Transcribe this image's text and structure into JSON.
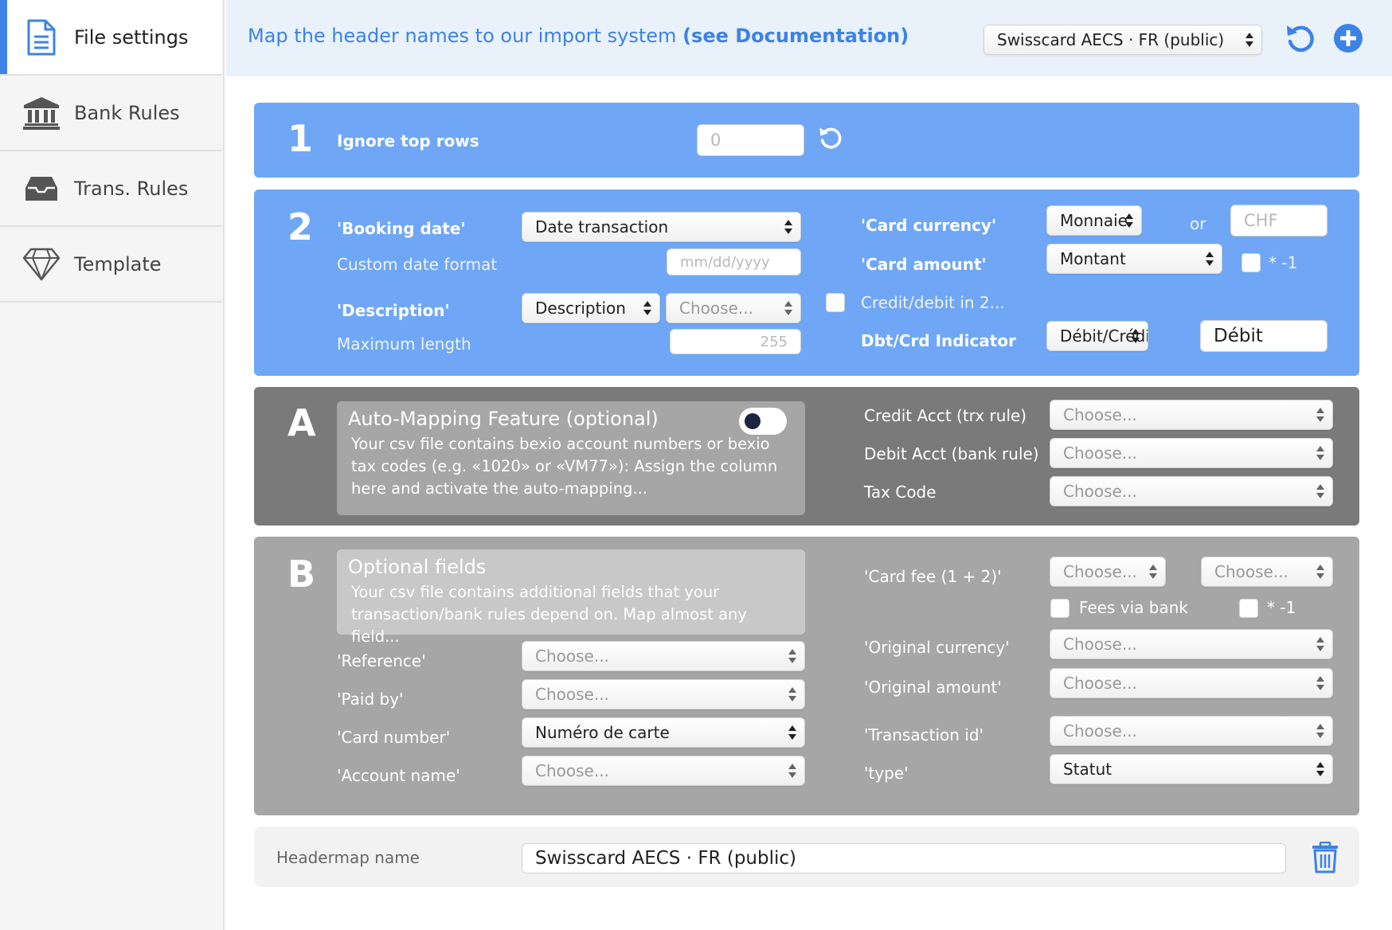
{
  "sidebar": {
    "items": [
      {
        "label": "File settings",
        "icon": "document-icon",
        "active": true
      },
      {
        "label": "Bank Rules",
        "icon": "bank-icon",
        "active": false
      },
      {
        "label": "Trans. Rules",
        "icon": "inbox-icon",
        "active": false
      },
      {
        "label": "Template",
        "icon": "diamond-icon",
        "active": false
      }
    ]
  },
  "header": {
    "text": "Map the header names to our import system",
    "link": "(see Documentation)",
    "headermap_select": "Swisscard AECS · FR (public)"
  },
  "section1": {
    "number": "1",
    "ignore_label": "Ignore top rows",
    "ignore_value": "0"
  },
  "section2": {
    "number": "2",
    "booking_label": "'Booking date'",
    "booking_value": "Date transaction",
    "custom_format_label": "Custom date format",
    "custom_format_placeholder": "mm/dd/yyyy",
    "description_label": "'Description'",
    "description_value": "Description",
    "description_second": "Choose...",
    "max_length_label": "Maximum length",
    "max_length_placeholder": "255",
    "card_currency_label": "'Card currency'",
    "card_currency_value": "Monnaie",
    "or_label": "or",
    "currency_placeholder": "CHF",
    "card_amount_label": "'Card amount'",
    "card_amount_value": "Montant",
    "multiply_label": "* -1",
    "credit_debit_label": "Credit/debit in 2...",
    "indicator_label": "Dbt/Crd Indicator",
    "indicator_value": "Débit/Crédit",
    "indicator_text": "Débit"
  },
  "sectionA": {
    "letter": "A",
    "title": "Auto-Mapping Feature (optional)",
    "text": "Your csv file contains bexio account numbers or bexio tax codes (e.g. «1020» or «VM77»): Assign the column here and activate the auto-mapping...",
    "credit_label": "Credit Acct (trx rule)",
    "debit_label": "Debit Acct (bank rule)",
    "tax_label": "Tax Code",
    "choose": "Choose..."
  },
  "sectionB": {
    "letter": "B",
    "title": "Optional fields",
    "text": "Your csv file contains additional fields that your transaction/bank rules depend on. Map almost any field...",
    "reference_label": "'Reference'",
    "paid_by_label": "'Paid by'",
    "card_number_label": "'Card number'",
    "card_number_value": "Numéro de carte",
    "account_name_label": "'Account name'",
    "card_fee_label": "'Card fee (1 + 2)'",
    "fees_via_bank_label": "Fees via bank",
    "multiply_label": "* -1",
    "original_currency_label": "'Original currency'",
    "original_amount_label": "'Original amount'",
    "transaction_id_label": "'Transaction id'",
    "type_label": "'type'",
    "type_value": "Statut",
    "choose": "Choose..."
  },
  "footer": {
    "label": "Headermap name",
    "value": "Swisscard AECS · FR (public)"
  },
  "colors": {
    "accent": "#3d82e6",
    "section_blue": "#6fa7f6",
    "section_dark_grey": "#7a7a7a",
    "section_grey": "#a6a6a6"
  }
}
